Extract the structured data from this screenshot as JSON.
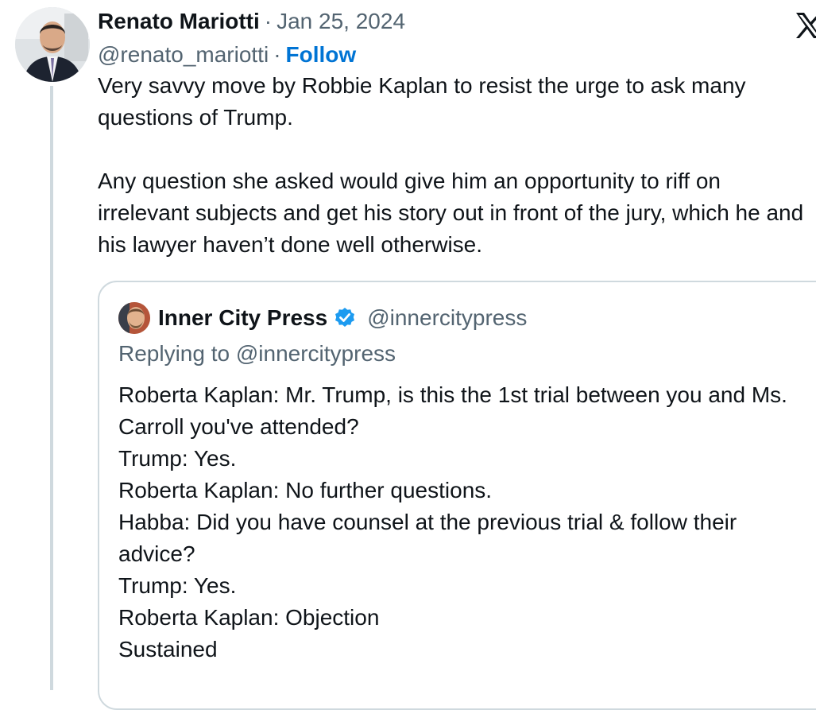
{
  "post": {
    "author_name": "Renato Mariotti",
    "separator": "·",
    "date": "Jan 25, 2024",
    "handle": "@renato_mariotti",
    "follow_label": "Follow",
    "paragraphs": [
      "Very savvy move by Robbie Kaplan to resist the urge to ask many questions of Trump.",
      "Any question she asked would give him an opportunity to riff on irrelevant subjects and get his story out in front of the jury, which he and his lawyer haven’t done well otherwise."
    ]
  },
  "quote": {
    "author_name": "Inner City Press",
    "verified": true,
    "handle": "@innercitypress",
    "replying_to": "Replying to @innercitypress",
    "lines": [
      "Roberta Kaplan: Mr. Trump, is this the 1st trial between you and Ms. Carroll you've attended?",
      "Trump: Yes.",
      "Roberta Kaplan: No further questions.",
      "Habba: Did you have counsel at the previous trial & follow their advice?",
      "Trump: Yes.",
      "Roberta Kaplan: Objection",
      "Sustained"
    ]
  },
  "icons": {
    "platform_logo": "x-logo-icon",
    "verified": "verified-badge-icon"
  },
  "colors": {
    "link_blue": "#0074d4",
    "verified_blue": "#1d9bf0",
    "secondary_text": "#536471",
    "border": "#cfd9de"
  }
}
